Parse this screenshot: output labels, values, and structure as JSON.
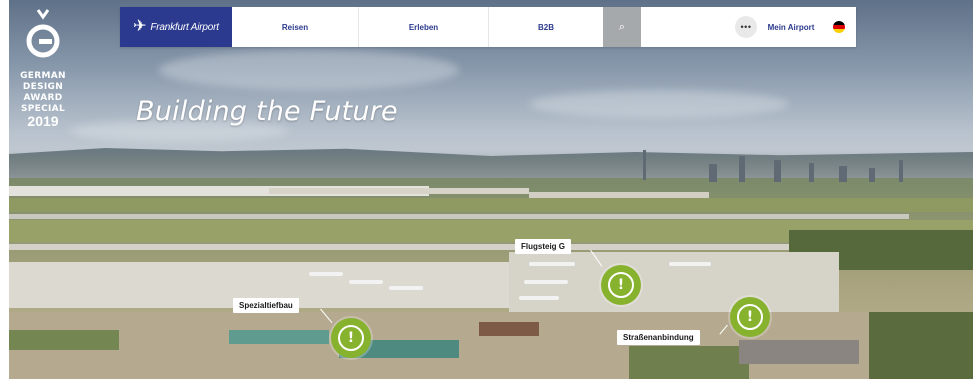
{
  "logo": {
    "text": "Frankfurt Airport",
    "mark": "✈"
  },
  "nav": {
    "items": [
      {
        "label": "Reisen"
      },
      {
        "label": "Erleben"
      },
      {
        "label": "B2B"
      }
    ],
    "search_icon": "⌕",
    "more_icon": "•••",
    "mein_airport": "Mein Airport",
    "language": "de"
  },
  "award": {
    "line1": "GERMAN",
    "line2": "DESIGN",
    "line3": "AWARD",
    "line4": "SPECIAL",
    "year": "2019"
  },
  "hero": {
    "headline": "Building the Future"
  },
  "hotspots": [
    {
      "label": "Flugsteig G",
      "icon": "!"
    },
    {
      "label": "Spezialtiefbau",
      "icon": "!"
    },
    {
      "label": "Straßenanbindung",
      "icon": "!"
    }
  ],
  "colors": {
    "brand_blue": "#2b3a8e",
    "hotspot_green": "#86b22e",
    "search_grey": "#a6a9ac"
  }
}
